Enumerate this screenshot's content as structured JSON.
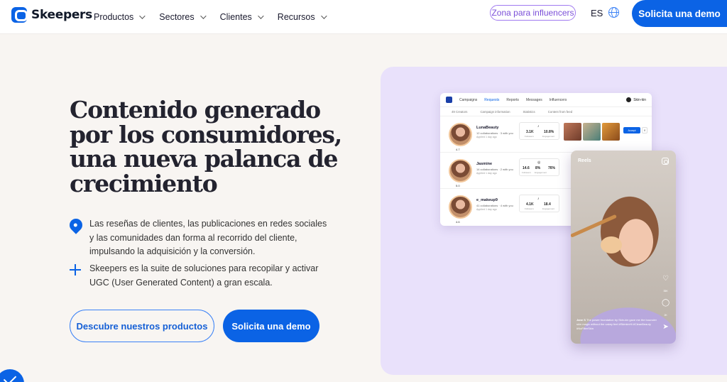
{
  "nav": {
    "logo_text": "Skeepers",
    "menu": [
      {
        "label": "Productos"
      },
      {
        "label": "Sectores"
      },
      {
        "label": "Clientes"
      },
      {
        "label": "Recursos"
      }
    ],
    "influencer_zone": "Zona para influencers",
    "language": "ES",
    "demo_button": "Solicita una demo"
  },
  "hero": {
    "title": "Contenido generado por los consumidores, una nueva palanca de crecimiento",
    "feature1": "Las reseñas de clientes, las publicaciones en redes sociales y las comunidades dan forma al recorrido del cliente, impulsando la adquisición y la conversión.",
    "feature2": "Skeepers es la suite de soluciones para recopilar y activar UGC (User Generated Content) a gran escala.",
    "btn_products": "Descubre nuestros productos",
    "btn_demo": "Solicita una demo"
  },
  "dashboard": {
    "tabs": [
      "Campaigns",
      "Requests",
      "Reports",
      "Messages",
      "Influencers"
    ],
    "user": "Skin-kin",
    "columns": [
      "49 Creators",
      "Campaign information",
      "Statistics",
      "Content from feed"
    ],
    "creators": [
      {
        "name": "LunaBeauty",
        "meta": "12 collaborations · 3 with you",
        "applied": "Applied 1 day ago",
        "rating": "4.7",
        "platform": "TikTok",
        "stat1": "3.1K",
        "stat2": "10.8%",
        "stat1_label": "Followers",
        "stat2_label": "Engagement",
        "accept": "Accept"
      },
      {
        "name": "Jasmine",
        "meta": "14 collaborations · 2 with you",
        "applied": "Applied 1 day ago",
        "rating": "5.0",
        "platform": "Instagram",
        "stat1": "14.6",
        "stat2": "8%",
        "stat3": "76%",
        "stat1_label": "Followers",
        "stat2_label": "Engagement"
      },
      {
        "name": "e_makeup9",
        "meta": "41 collaborations · 4 with you",
        "applied": "Applied 1 day ago",
        "rating": "4.6",
        "platform": "TikTok",
        "stat1": "4.1K",
        "stat2": "18.4",
        "stat1_label": "Followers",
        "stat2_label": "Engagement"
      }
    ]
  },
  "reel": {
    "label": "Reels",
    "author": "Jane S",
    "caption": "The power foundation by Skin-kin gave me the bouncier skin magic without the cakey feel",
    "hashtags": "#SkinkinHi #CleanBeauty #NoFilterSkin",
    "likes": "35K",
    "comments": "2K"
  },
  "colors": {
    "brand_blue": "#0b63e5",
    "panel_lavender": "#e9e1fb",
    "influencer_purple": "#7b4fd8",
    "page_bg": "#f8f5f2"
  }
}
